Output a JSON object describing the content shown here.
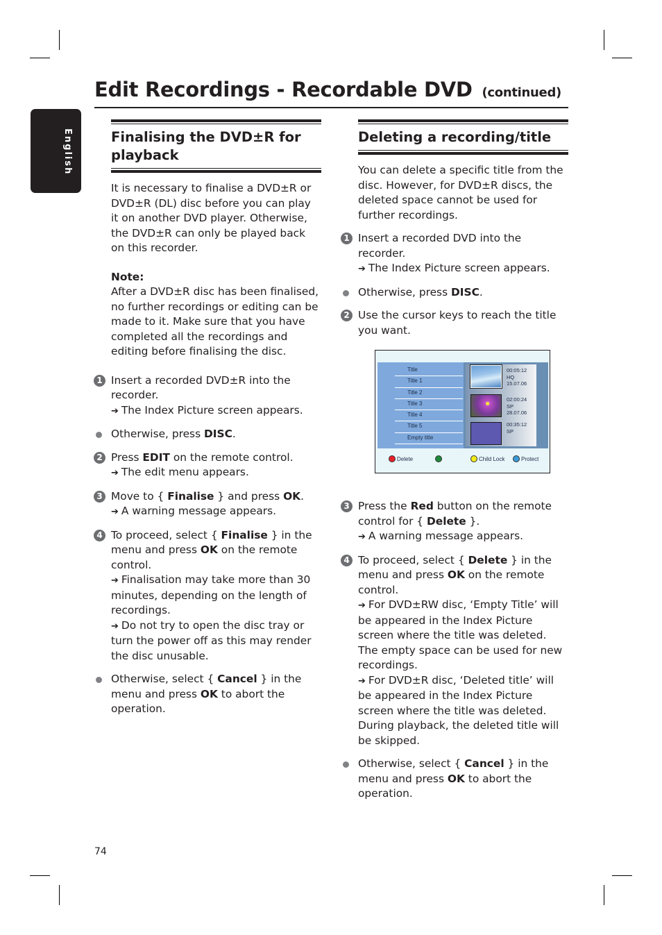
{
  "page": {
    "title": "Edit Recordings - Recordable DVD",
    "title_suffix": "(continued)",
    "language_tab": "English",
    "page_number": "74"
  },
  "left": {
    "heading": "Finalising the DVD±R for playback",
    "intro": "It is necessary to finalise a DVD±R or DVD±R (DL) disc before you can play it on another DVD player. Otherwise, the DVD±R can only be played back on this recorder.",
    "note_label": "Note:",
    "note_text": "After a DVD±R disc has been finalised, no further recordings or editing can be made to it. Make sure that you have completed all the recordings and editing before finalising the disc.",
    "steps": [
      {
        "marker": "1",
        "text": "Insert a recorded DVD±R into the recorder.",
        "results": [
          "The Index Picture screen appears."
        ]
      },
      {
        "marker": "bullet",
        "pre": "Otherwise, press ",
        "bold": "DISC",
        "post": "."
      },
      {
        "marker": "2",
        "pre": "Press ",
        "bold": "EDIT",
        "post": " on the remote control.",
        "results": [
          "The edit menu appears."
        ]
      },
      {
        "marker": "3",
        "pre": "Move to { ",
        "bold": "Finalise",
        "mid": " } and press ",
        "bold2": "OK",
        "post": ".",
        "results": [
          "A warning message appears."
        ]
      },
      {
        "marker": "4",
        "pre": "To proceed, select { ",
        "bold": "Finalise",
        "mid": " } in the menu and press ",
        "bold2": "OK",
        "post": " on the remote control.",
        "results": [
          "Finalisation may take more than 30 minutes, depending on the length of recordings.",
          "Do not try to open the disc tray or turn the power off as this may render the disc unusable."
        ]
      },
      {
        "marker": "bullet",
        "pre": "Otherwise, select { ",
        "bold": "Cancel",
        "mid": " } in the menu and press ",
        "bold2": "OK",
        "post": " to abort the operation."
      }
    ]
  },
  "right": {
    "heading": "Deleting a recording/title",
    "intro": "You can delete a specific title from the disc. However, for DVD±R discs, the deleted space cannot be used for further recordings.",
    "steps": [
      {
        "marker": "1",
        "text": "Insert a recorded DVD into the recorder.",
        "results": [
          "The Index Picture screen appears."
        ]
      },
      {
        "marker": "bullet",
        "pre": "Otherwise, press ",
        "bold": "DISC",
        "post": "."
      },
      {
        "marker": "2",
        "text": "Use the cursor keys to reach the title you want."
      },
      {
        "marker": "3",
        "pre": "Press the ",
        "bold": "Red",
        "mid": " button on the remote control for { ",
        "bold2": "Delete",
        "post": " }.",
        "results": [
          "A warning message appears."
        ]
      },
      {
        "marker": "4",
        "pre": "To proceed, select { ",
        "bold": "Delete",
        "mid": " } in the menu and press ",
        "bold2": "OK",
        "post": " on the remote control.",
        "results": [
          "For DVD±RW disc, ‘Empty Title’ will be appeared in the Index Picture screen where the title was deleted. The empty space can be used for new recordings.",
          "For DVD±R disc, ‘Deleted title’ will be appeared in the Index Picture screen where the title was deleted. During playback, the deleted title will be skipped."
        ]
      },
      {
        "marker": "bullet",
        "pre": "Otherwise, select { ",
        "bold": "Cancel",
        "mid": " } in the menu and press ",
        "bold2": "OK",
        "post": " to abort the operation."
      }
    ]
  },
  "screen": {
    "titles": [
      "Title",
      "Title 1",
      "Title 2",
      "Title 3",
      "Title 4",
      "Title 5",
      "Empty title"
    ],
    "thumbnails": [
      {
        "image": "surfer-thumbnail",
        "lines": [
          "00:05:12",
          "HQ",
          "15.07.06"
        ]
      },
      {
        "image": "flower-thumbnail",
        "lines": [
          "02:00:24",
          "SP",
          "28.07.06"
        ]
      },
      {
        "image": "empty-thumbnail",
        "lines": [
          "00:35:12",
          "SP"
        ]
      }
    ],
    "legend": [
      {
        "color": "#e8202a",
        "label": "Delete"
      },
      {
        "color": "#1f8a3a",
        "label": ""
      },
      {
        "color": "#f2ea1c",
        "label": "Child Lock"
      },
      {
        "color": "#3a9ad8",
        "label": "Protect"
      }
    ]
  }
}
